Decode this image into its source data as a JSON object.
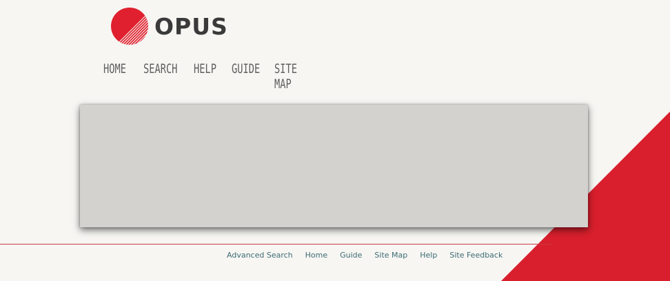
{
  "brand": {
    "name": "OPUS",
    "accent_color": "#d91f2d",
    "text_color": "#3a3a3a"
  },
  "nav": {
    "items": [
      {
        "label": "HOME"
      },
      {
        "label": "SEARCH"
      },
      {
        "label": "HELP"
      },
      {
        "label": "GUIDE"
      },
      {
        "label": "SITE MAP"
      }
    ]
  },
  "footer": {
    "links": [
      {
        "label": "Advanced Search"
      },
      {
        "label": "Home"
      },
      {
        "label": "Guide"
      },
      {
        "label": "Site Map"
      },
      {
        "label": "Help"
      },
      {
        "label": "Site Feedback"
      }
    ]
  }
}
